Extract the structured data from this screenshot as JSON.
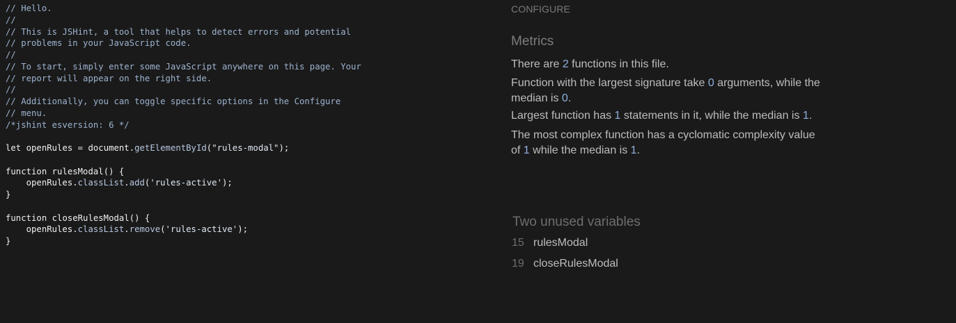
{
  "editor": {
    "lines": [
      [
        {
          "t": "// Hello.",
          "c": "comment"
        }
      ],
      [
        {
          "t": "//",
          "c": "comment"
        }
      ],
      [
        {
          "t": "// This is JSHint, a tool that helps to detect errors and potential",
          "c": "comment"
        }
      ],
      [
        {
          "t": "// problems in your JavaScript code.",
          "c": "comment"
        }
      ],
      [
        {
          "t": "//",
          "c": "comment"
        }
      ],
      [
        {
          "t": "// To start, simply enter some JavaScript anywhere on this page. Your",
          "c": "comment"
        }
      ],
      [
        {
          "t": "// report will appear on the right side.",
          "c": "comment"
        }
      ],
      [
        {
          "t": "//",
          "c": "comment"
        }
      ],
      [
        {
          "t": "// Additionally, you can toggle specific options in the Configure",
          "c": "comment"
        }
      ],
      [
        {
          "t": "// menu.",
          "c": "comment"
        }
      ],
      [
        {
          "t": "/*jshint esversion: 6 */",
          "c": "comment"
        }
      ],
      [],
      [
        {
          "t": "let ",
          "c": "kw"
        },
        {
          "t": "openRules",
          "c": "ident"
        },
        {
          "t": " = ",
          "c": "punct"
        },
        {
          "t": "document",
          "c": "ident"
        },
        {
          "t": ".",
          "c": "punct"
        },
        {
          "t": "getElementById",
          "c": "method"
        },
        {
          "t": "(",
          "c": "punct"
        },
        {
          "t": "\"rules-modal\"",
          "c": "string"
        },
        {
          "t": ");",
          "c": "punct"
        }
      ],
      [],
      [
        {
          "t": "function ",
          "c": "kw"
        },
        {
          "t": "rulesModal",
          "c": "ident"
        },
        {
          "t": "() {",
          "c": "punct"
        }
      ],
      [
        {
          "t": "    openRules",
          "c": "ident"
        },
        {
          "t": ".",
          "c": "punct"
        },
        {
          "t": "classList",
          "c": "method"
        },
        {
          "t": ".",
          "c": "punct"
        },
        {
          "t": "add",
          "c": "method"
        },
        {
          "t": "(",
          "c": "punct"
        },
        {
          "t": "'rules-active'",
          "c": "string"
        },
        {
          "t": ");",
          "c": "punct"
        }
      ],
      [
        {
          "t": "}",
          "c": "punct"
        }
      ],
      [],
      [
        {
          "t": "function ",
          "c": "kw"
        },
        {
          "t": "closeRulesModal",
          "c": "ident"
        },
        {
          "t": "() {",
          "c": "punct"
        }
      ],
      [
        {
          "t": "    openRules",
          "c": "ident"
        },
        {
          "t": ".",
          "c": "punct"
        },
        {
          "t": "classList",
          "c": "method"
        },
        {
          "t": ".",
          "c": "punct"
        },
        {
          "t": "remove",
          "c": "method"
        },
        {
          "t": "(",
          "c": "punct"
        },
        {
          "t": "'rules-active'",
          "c": "string"
        },
        {
          "t": ");",
          "c": "punct"
        }
      ],
      [
        {
          "t": "}",
          "c": "punct"
        }
      ]
    ]
  },
  "report": {
    "configure_label": "CONFIGURE",
    "metrics_title": "Metrics",
    "metrics": [
      {
        "segments": [
          {
            "t": "There are "
          },
          {
            "t": "2",
            "n": true
          },
          {
            "t": " functions in this file."
          }
        ]
      },
      {
        "segments": [
          {
            "t": "Function with the largest signature take "
          },
          {
            "t": "0",
            "n": true
          },
          {
            "t": " arguments, while the median is "
          },
          {
            "t": "0",
            "n": true
          },
          {
            "t": "."
          }
        ]
      },
      {
        "segments": [
          {
            "t": "Largest function has "
          },
          {
            "t": "1",
            "n": true
          },
          {
            "t": " statements in it, while the median is "
          },
          {
            "t": "1",
            "n": true
          },
          {
            "t": "."
          }
        ]
      },
      {
        "segments": [
          {
            "t": "The most complex function has a cyclomatic complexity value of "
          },
          {
            "t": "1",
            "n": true
          },
          {
            "t": " while the median is "
          },
          {
            "t": "1",
            "n": true
          },
          {
            "t": "."
          }
        ]
      }
    ],
    "unused_title": "Two unused variables",
    "unused": [
      {
        "line": "15",
        "name": "rulesModal"
      },
      {
        "line": "19",
        "name": "closeRulesModal"
      }
    ]
  },
  "colors": {
    "background": "#1a1a1a",
    "comment": "#9db3cf",
    "code_text": "#f0f0f0",
    "report_text": "#bdbdbd",
    "report_number": "#8fb0de",
    "muted_heading": "#7d7d7d"
  }
}
